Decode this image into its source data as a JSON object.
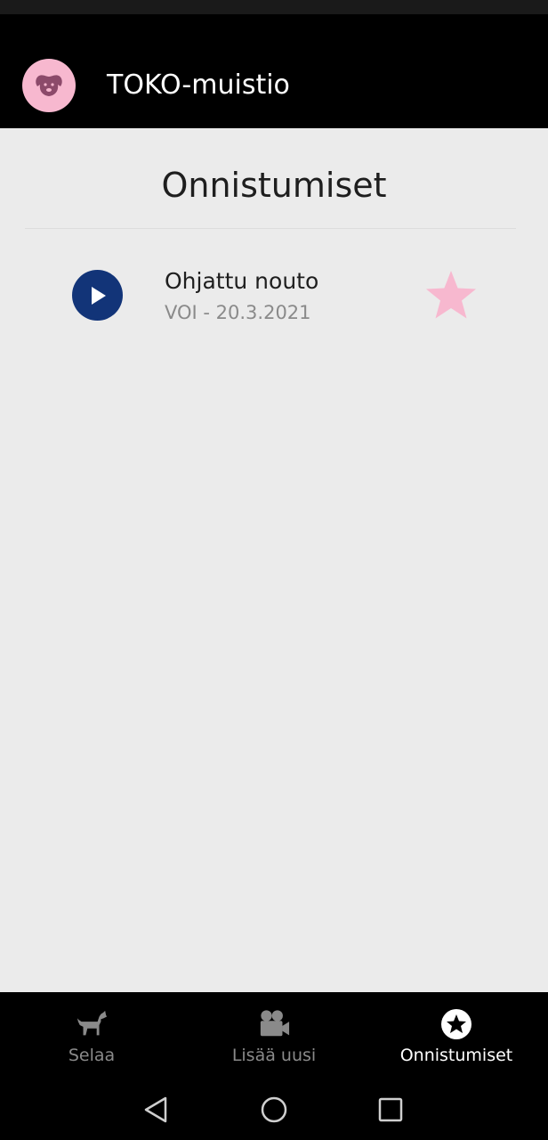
{
  "app": {
    "title": "TOKO-muistio"
  },
  "page": {
    "title": "Onnistumiset"
  },
  "achievements": [
    {
      "title": "Ohjattu nouto",
      "subtitle": "VOI - 20.3.2021",
      "favorite": true
    }
  ],
  "bottom_nav": {
    "items": [
      {
        "label": "Selaa",
        "icon": "dog-icon",
        "active": false
      },
      {
        "label": "Lisää uusi",
        "icon": "video-camera-icon",
        "active": false
      },
      {
        "label": "Onnistumiset",
        "icon": "star-circle-icon",
        "active": true
      }
    ]
  },
  "system_nav": [
    "back",
    "home",
    "recents"
  ],
  "colors": {
    "app_bar": "#000000",
    "logo_bg": "#f7b8cf",
    "play_button": "#123478",
    "star": "#f7b8cf",
    "background": "#ebebeb"
  }
}
